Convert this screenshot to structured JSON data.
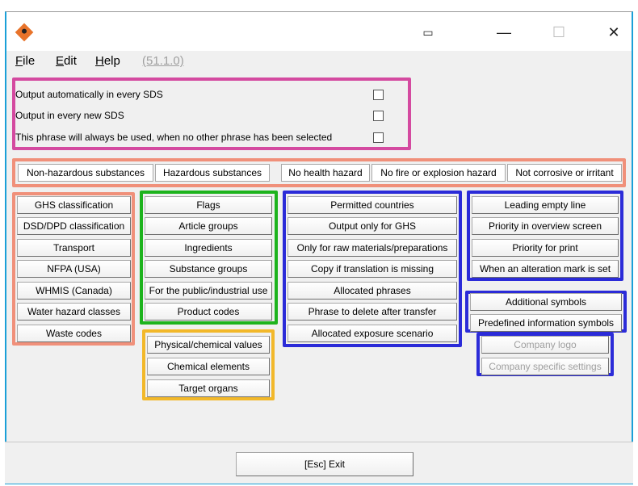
{
  "window": {
    "minimize": "—",
    "maximize": "☐",
    "close": "✕"
  },
  "menu": {
    "file": "File",
    "edit": "Edit",
    "help": "Help",
    "version": "(51.1.0)"
  },
  "options": [
    "Output automatically in every SDS",
    "Output in every new SDS",
    "This phrase will always be used, when no other phrase has been selected"
  ],
  "tabs": [
    "Non-hazardous substances",
    "Hazardous substances",
    "No health hazard",
    "No fire or explosion hazard",
    "Not corrosive or irritant"
  ],
  "col1": [
    "GHS classification",
    "DSD/DPD classification",
    "Transport",
    "NFPA (USA)",
    "WHMIS (Canada)",
    "Water hazard classes",
    "Waste codes"
  ],
  "col2": [
    "Flags",
    "Article groups",
    "Ingredients",
    "Substance groups",
    "For the public/industrial use",
    "Product codes"
  ],
  "col2b": [
    "Physical/chemical values",
    "Chemical elements",
    "Target organs"
  ],
  "col3": [
    "Permitted countries",
    "Output only for GHS",
    "Only for raw materials/preparations",
    "Copy if translation is missing",
    "Allocated phrases",
    "Phrase to delete after transfer",
    "Allocated exposure scenario"
  ],
  "col4": [
    "Leading empty line",
    "Priority in overview screen",
    "Priority for print",
    "When an alteration mark is set"
  ],
  "col4b": [
    "Additional symbols",
    "Predefined information symbols"
  ],
  "col4c": [
    "Company logo",
    "Company specific settings"
  ],
  "exit_button": "[Esc] Exit"
}
